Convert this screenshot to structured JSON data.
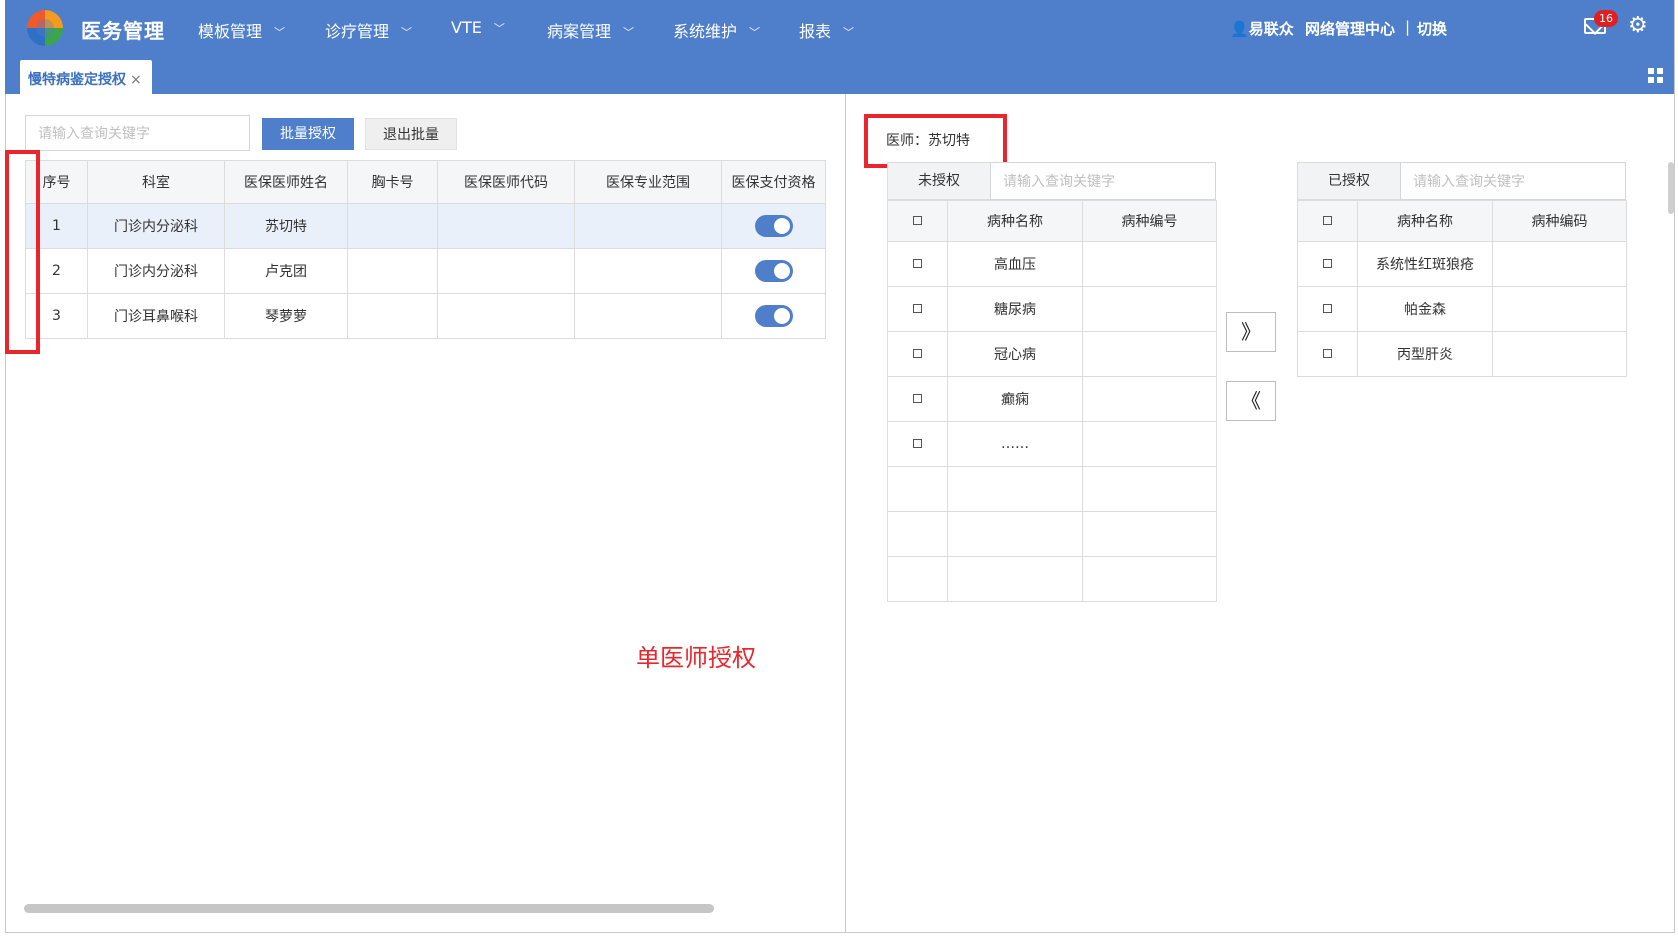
{
  "app": {
    "title": "医务管理"
  },
  "nav": [
    {
      "label": "模板管理"
    },
    {
      "label": "诊疗管理"
    },
    {
      "label": "VTE"
    },
    {
      "label": "病案管理"
    },
    {
      "label": "系统维护"
    },
    {
      "label": "报表"
    }
  ],
  "user": {
    "name": "易联众",
    "org": "网络管理中心",
    "separator": "|",
    "switch_label": "切换",
    "mail_count": "16"
  },
  "tab": {
    "label": "慢特病鉴定授权",
    "close": "×"
  },
  "left": {
    "search_placeholder": "请输入查询关键字",
    "batch_auth": "批量授权",
    "exit_batch": "退出批量",
    "columns": [
      "序号",
      "科室",
      "医保医师姓名",
      "胸卡号",
      "医保医师代码",
      "医保专业范围",
      "医保支付资格"
    ],
    "rows": [
      {
        "no": "1",
        "dept": "门诊内分泌科",
        "name": "苏切特",
        "badge": "",
        "code": "",
        "scope": "",
        "qualified": true
      },
      {
        "no": "2",
        "dept": "门诊内分泌科",
        "name": "卢克团",
        "badge": "",
        "code": "",
        "scope": "",
        "qualified": true
      },
      {
        "no": "3",
        "dept": "门诊耳鼻喉科",
        "name": "琴萝萝",
        "badge": "",
        "code": "",
        "scope": "",
        "qualified": true
      }
    ],
    "annotation": "单医师授权"
  },
  "right": {
    "doctor_label": "医师：苏切特",
    "unauth": {
      "label": "未授权",
      "search_placeholder": "请输入查询关键字",
      "columns": [
        "病种名称",
        "病种编号"
      ],
      "rows": [
        {
          "name": "高血压",
          "code": ""
        },
        {
          "name": "糖尿病",
          "code": ""
        },
        {
          "name": "冠心病",
          "code": ""
        },
        {
          "name": "癫痫",
          "code": ""
        },
        {
          "name": "……",
          "code": ""
        }
      ]
    },
    "auth": {
      "label": "已授权",
      "search_placeholder": "请输入查询关键字",
      "columns": [
        "病种名称",
        "病种编码"
      ],
      "rows": [
        {
          "name": "系统性红斑狼疮",
          "code": ""
        },
        {
          "name": "帕金森",
          "code": ""
        },
        {
          "name": "丙型肝炎",
          "code": ""
        }
      ]
    },
    "move_right": "》",
    "move_left": "《"
  },
  "colors": {
    "primary": "#4f7fcb",
    "highlight": "#e8262b"
  }
}
